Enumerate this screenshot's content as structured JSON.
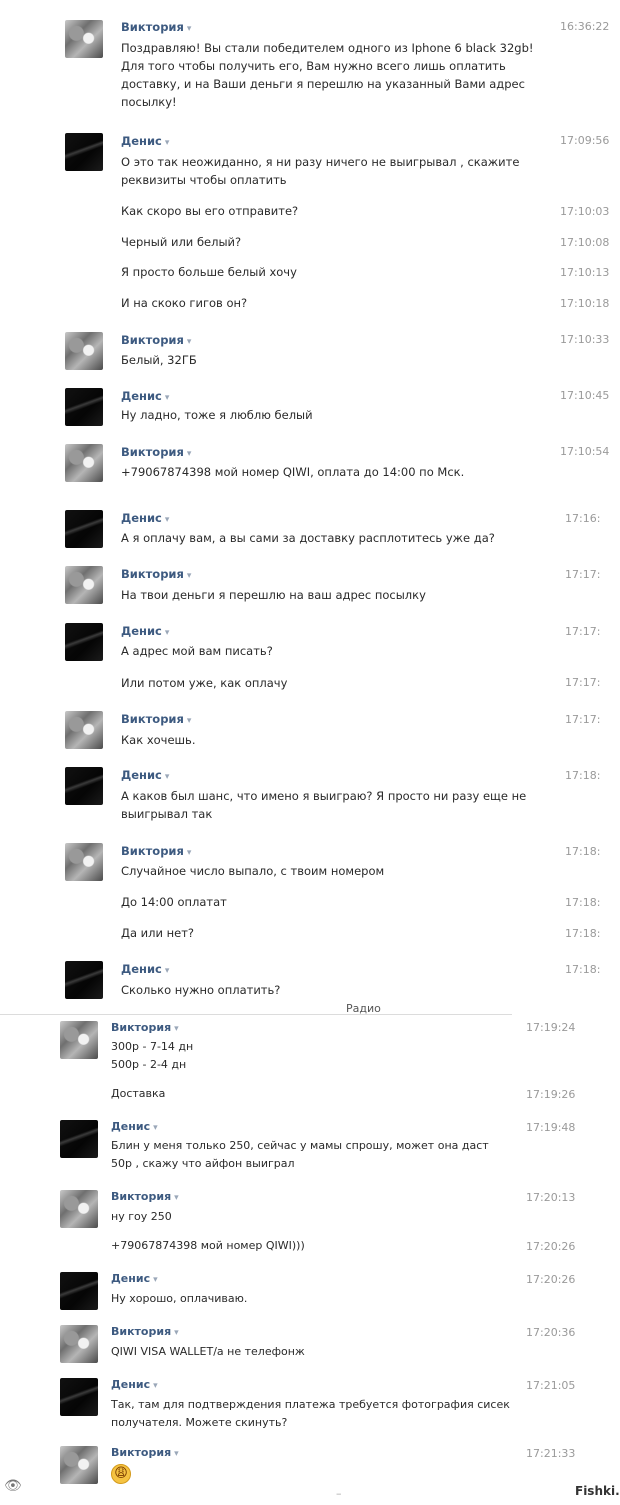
{
  "users": {
    "viktoria": "Виктория",
    "denis": "Денис"
  },
  "radio_label": "Радио",
  "footer_mark": "–",
  "watermark": "Fishki.net",
  "eye_glyph": "👁",
  "caret": "▾",
  "messages": [
    {
      "time": "16:36:22",
      "text": "Поздравляю! Вы стали победителем одного из Iphone 6 black 32gb! Для того чтобы получить его, Вам нужно всего лишь оплатить доставку, и на Ваши деньги я перешлю на указанный Вами адрес посылку!"
    },
    {
      "time": "17:09:56",
      "text": "О это так неожиданно, я ни разу ничего не выигрывал , скажите реквизиты чтобы оплатить"
    },
    {
      "time": "17:10:03",
      "text": "Как скоро вы его отправите?"
    },
    {
      "time": "17:10:08",
      "text": "Черный или белый?"
    },
    {
      "time": "17:10:13",
      "text": "Я просто больше белый хочу"
    },
    {
      "time": "17:10:18",
      "text": "И на скоко гигов он?"
    },
    {
      "time": "17:10:33",
      "text": "Белый, 32ГБ"
    },
    {
      "time": "17:10:45",
      "text": "Ну ладно, тоже я люблю белый"
    },
    {
      "time": "17:10:54",
      "text": "+79067874398 мой номер QIWI, оплата до 14:00 по Мск."
    },
    {
      "time": "17:16:",
      "text": "А я оплачу вам, а вы сами за доставку расплотитесь уже да?"
    },
    {
      "time": "17:17:",
      "text": "На твои деньги я перешлю на ваш адрес посылку"
    },
    {
      "time": "17:17:",
      "text": "А адрес мой вам писать?"
    },
    {
      "time": "17:17:",
      "text": "Или потом уже, как оплачу"
    },
    {
      "time": "17:17:",
      "text": "Как хочешь."
    },
    {
      "time": "17:18:",
      "text": "А каков был шанс, что имено я выиграю? Я просто ни разу еще не выигрывал так"
    },
    {
      "time": "17:18:",
      "text": "Случайное число выпало, с твоим номером"
    },
    {
      "time": "17:18:",
      "text": "До 14:00 оплатат"
    },
    {
      "time": "17:18:",
      "text": "Да или нет?"
    },
    {
      "time": "17:18:",
      "text": "Сколько нужно оплатить?"
    },
    {
      "time": "17:19:24",
      "text": "300р - 7-14 дн"
    },
    {
      "time": "",
      "text": "500р - 2-4 дн"
    },
    {
      "time": "17:19:26",
      "text": "Доставка"
    },
    {
      "time": "17:19:48",
      "text": "Блин у меня только 250, сейчас у мамы спрошу, может она даст 50р , скажу что айфон выиграл"
    },
    {
      "time": "17:20:13",
      "text": "ну гоу 250"
    },
    {
      "time": "17:20:26",
      "text": "+79067874398 мой номер QIWI)))"
    },
    {
      "time": "17:20:26",
      "text": "Ну хорошо, оплачиваю."
    },
    {
      "time": "17:20:36",
      "text": "QIWI VISA WALLET/а не телефонж"
    },
    {
      "time": "17:21:05",
      "text": "Так, там для подтверждения платежа требуется фотография сисек получателя. Можете скинуть?"
    },
    {
      "time": "17:21:33",
      "text": "😩"
    }
  ]
}
